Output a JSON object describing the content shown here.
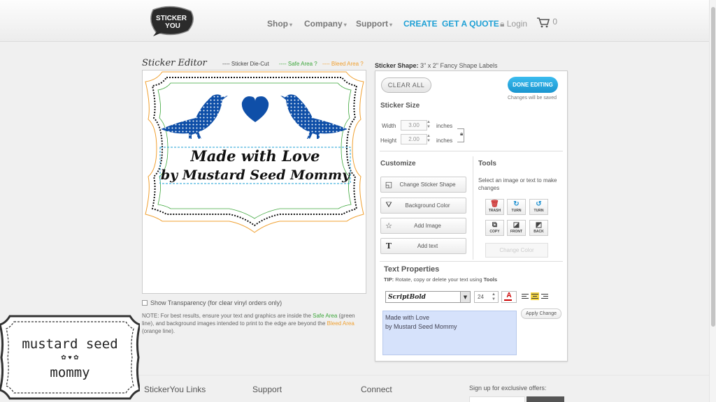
{
  "header": {
    "logo_text_top": "STICKER",
    "logo_text_bottom": "YOU",
    "nav": [
      {
        "label": "Shop",
        "caret": "▾"
      },
      {
        "label": "Company",
        "caret": "▾"
      },
      {
        "label": "Support",
        "caret": "▾"
      }
    ],
    "create": "CREATE",
    "quote": "GET A QUOTE",
    "login": "Login",
    "cart_count": "0"
  },
  "editor": {
    "title": "Sticker Editor",
    "legend_diecut": "---- Sticker Die-Cut",
    "legend_safe": "---- Safe Area ?",
    "legend_bleed": "---- Bleed Area ?",
    "sticker_line1": "Made with Love",
    "sticker_line2": "by Mustard Seed Mommy",
    "show_transparency": "Show Transparency (for clear vinyl orders only)",
    "note_prefix": "NOTE: For best results, ensure your text and graphics are inside the",
    "note_safe": "Safe Area",
    "note_middle": "(green line), and background images intended to print to the edge are beyond the",
    "note_bleed": "Bleed Area",
    "note_suffix": "(orange line)."
  },
  "panel": {
    "shape_label": "Sticker Shape:",
    "shape_value": "3\" x 2\" Fancy Shape Labels",
    "clear_all": "CLEAR ALL",
    "done_editing": "DONE EDITING",
    "changes_saved": "Changes will be saved",
    "sticker_size": "Sticker Size",
    "width_label": "Width",
    "width_value": "3.00",
    "height_label": "Height",
    "height_value": "2.00",
    "inches": "inches",
    "customize": "Customize",
    "change_shape": "Change Sticker Shape",
    "background_color": "Background Color",
    "add_image": "Add Image",
    "add_text": "Add text",
    "tools": "Tools",
    "tools_text": "Select an image or text to make changes",
    "tool_trash": "TRASH",
    "tool_turn": "TURN",
    "tool_copy": "COPY",
    "tool_front": "FRONT",
    "tool_back": "BACK",
    "change_color": "Change Color",
    "text_properties": "Text Properties",
    "tip_label": "TIP:",
    "tip_text": "Rotate, copy or delete your text using",
    "tip_tools": "Tools",
    "font": "ScriptBold",
    "font_size": "24",
    "text_color_glyph": "A",
    "text_content": "Made with Love\nby Mustard Seed Mommy",
    "apply_change": "Apply Change"
  },
  "footer": {
    "links": "StickerYou Links",
    "support": "Support",
    "connect": "Connect",
    "signup": "Sign up for exclusive offers:"
  },
  "watermark": {
    "line1": "mustard seed",
    "line2": "mommy"
  },
  "colors": {
    "accent": "#1ea0d5",
    "bird_blue": "#0f4fa8",
    "safe_green": "#3da63b",
    "bleed_orange": "#f0a030"
  }
}
